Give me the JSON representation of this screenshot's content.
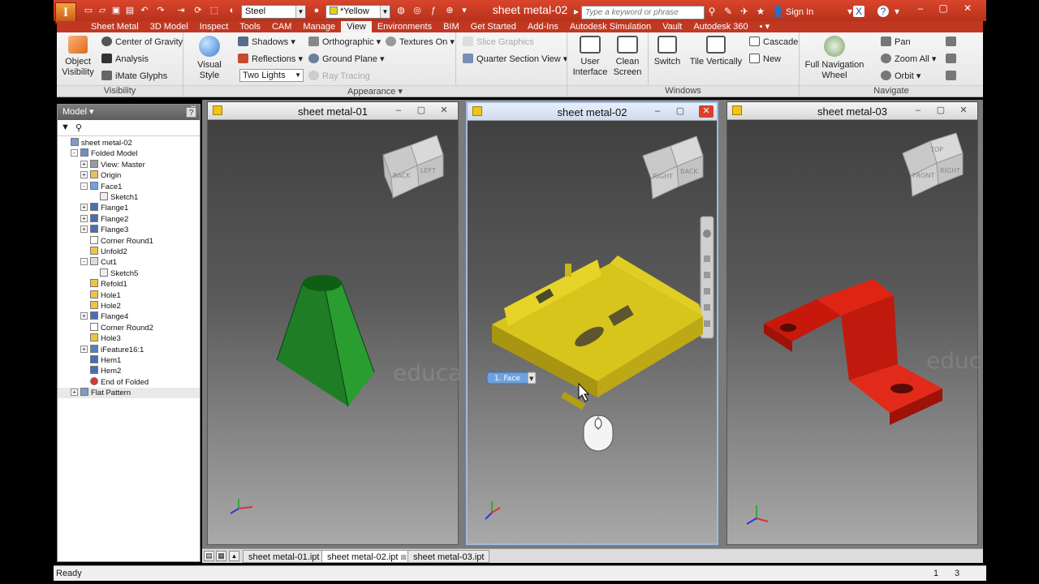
{
  "app": {
    "logo": "I",
    "document_title": "sheet metal-02"
  },
  "quick_access": {
    "material": "Steel",
    "appearance": "*Yellow",
    "search_placeholder": "Type a keyword or phrase",
    "sign_in": "Sign In"
  },
  "ribbon_tabs": [
    "Sheet Metal",
    "3D Model",
    "Inspect",
    "Tools",
    "CAM",
    "Manage",
    "View",
    "Environments",
    "BIM",
    "Get Started",
    "Add-Ins",
    "Autodesk Simulation",
    "Vault",
    "Autodesk 360"
  ],
  "active_tab": "View",
  "ribbon": {
    "visibility": {
      "group_label": "Visibility",
      "object_visibility": [
        "Object",
        "Visibility"
      ],
      "center_of_gravity": "Center of Gravity",
      "analysis": "Analysis",
      "imate_glyphs": "iMate Glyphs"
    },
    "appearance": {
      "group_label": "Appearance",
      "visual_style": "Visual Style",
      "shadows": "Shadows",
      "reflections": "Reflections",
      "lighting": "Two Lights",
      "orthographic": "Orthographic",
      "ground_plane": "Ground Plane",
      "ray_tracing": "Ray Tracing",
      "textures_on": "Textures On",
      "slice_graphics": "Slice Graphics",
      "quarter_section": "Quarter Section View"
    },
    "windows": {
      "group_label": "Windows",
      "user_interface": [
        "User",
        "Interface"
      ],
      "clean_screen": [
        "Clean",
        "Screen"
      ],
      "switch": "Switch",
      "tile_vertically": "Tile Vertically",
      "cascade": "Cascade",
      "new": "New"
    },
    "navigate": {
      "group_label": "Navigate",
      "full_nav_wheel": [
        "Full Navigation",
        "Wheel"
      ],
      "pan": "Pan",
      "zoom_all": "Zoom All",
      "orbit": "Orbit"
    }
  },
  "browser": {
    "title": "Model",
    "help": "?",
    "items": [
      {
        "label": "sheet metal-02",
        "level": 0,
        "icon": "part-icon",
        "exp": ""
      },
      {
        "label": "Folded Model",
        "level": 1,
        "icon": "folded-model-icon",
        "exp": "-"
      },
      {
        "label": "View: Master",
        "level": 2,
        "icon": "view-icon",
        "exp": "+"
      },
      {
        "label": "Origin",
        "level": 2,
        "icon": "folder-icon",
        "exp": "+"
      },
      {
        "label": "Face1",
        "level": 2,
        "icon": "face-icon",
        "exp": "-"
      },
      {
        "label": "Sketch1",
        "level": 3,
        "icon": "sketch-icon",
        "exp": ""
      },
      {
        "label": "Flange1",
        "level": 2,
        "icon": "flange-icon",
        "exp": "+"
      },
      {
        "label": "Flange2",
        "level": 2,
        "icon": "flange-icon",
        "exp": "+"
      },
      {
        "label": "Flange3",
        "level": 2,
        "icon": "flange-icon",
        "exp": "+"
      },
      {
        "label": "Corner Round1",
        "level": 2,
        "icon": "corner-round-icon",
        "exp": ""
      },
      {
        "label": "Unfold2",
        "level": 2,
        "icon": "unfold-icon",
        "exp": ""
      },
      {
        "label": "Cut1",
        "level": 2,
        "icon": "cut-icon",
        "exp": "-"
      },
      {
        "label": "Sketch5",
        "level": 3,
        "icon": "sketch-icon",
        "exp": ""
      },
      {
        "label": "Refold1",
        "level": 2,
        "icon": "refold-icon",
        "exp": ""
      },
      {
        "label": "Hole1",
        "level": 2,
        "icon": "hole-icon",
        "exp": ""
      },
      {
        "label": "Hole2",
        "level": 2,
        "icon": "hole-icon",
        "exp": ""
      },
      {
        "label": "Flange4",
        "level": 2,
        "icon": "flange-icon",
        "exp": "+"
      },
      {
        "label": "Corner Round2",
        "level": 2,
        "icon": "corner-round-icon",
        "exp": ""
      },
      {
        "label": "Hole3",
        "level": 2,
        "icon": "hole-icon",
        "exp": ""
      },
      {
        "label": "iFeature16:1",
        "level": 2,
        "icon": "ifeature-icon",
        "exp": "+"
      },
      {
        "label": "Hem1",
        "level": 2,
        "icon": "hem-icon",
        "exp": ""
      },
      {
        "label": "Hem2",
        "level": 2,
        "icon": "hem-icon",
        "exp": ""
      },
      {
        "label": "End of Folded",
        "level": 2,
        "icon": "end-of-folded-icon",
        "exp": ""
      },
      {
        "label": "Flat Pattern",
        "level": 1,
        "icon": "flat-pattern-icon",
        "exp": "+"
      }
    ]
  },
  "viewports": [
    {
      "title": "sheet metal-01",
      "cube_faces": [
        "FRONT",
        "BACK",
        "LEFT"
      ],
      "color": "#1c8a1c"
    },
    {
      "title": "sheet metal-02",
      "cube_faces": [
        "BACK",
        "RIGHT",
        "BACK"
      ],
      "color": "#d4c21a"
    },
    {
      "title": "sheet metal-03",
      "cube_faces": [
        "TOP",
        "FRONT",
        "RIGHT"
      ],
      "color": "#d81e10"
    }
  ],
  "context_menu": {
    "label": "1. Face"
  },
  "watermark": "educat",
  "doc_tabs": [
    "sheet metal-01.ipt",
    "sheet metal-02.ipt",
    "sheet metal-03.ipt"
  ],
  "status": {
    "text": "Ready",
    "count1": "1",
    "count2": "3"
  },
  "colors": {
    "title_red": "#c0392b",
    "active_tab_bg": "#f2f2f2",
    "viewport_active_border": "#9fbbe0"
  }
}
